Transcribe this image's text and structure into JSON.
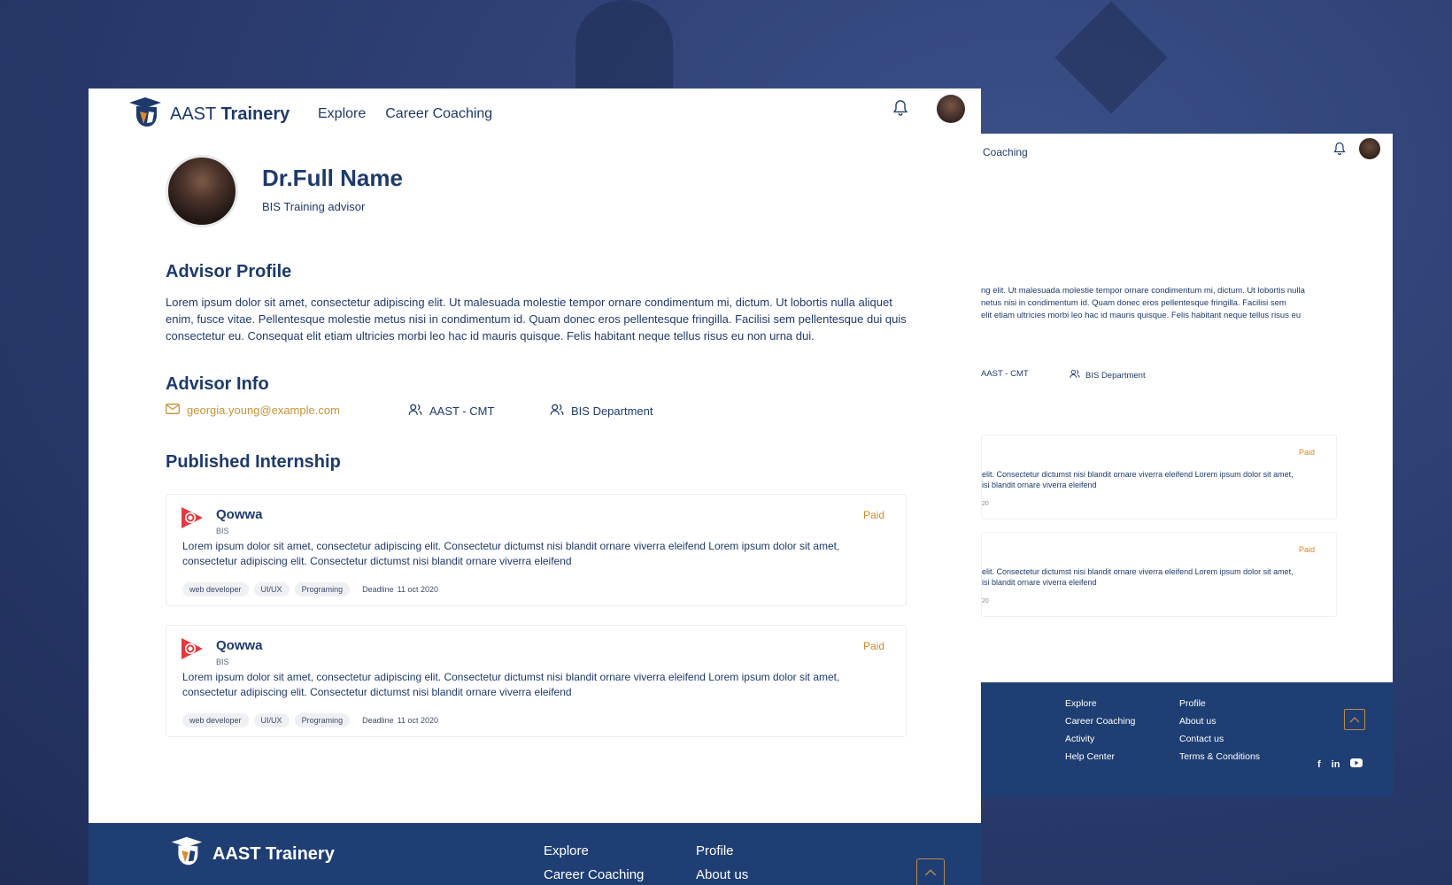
{
  "brand": {
    "name_light": "AAST",
    "name_bold": "Trainery",
    "footer_name": "AAST Trainery"
  },
  "nav": {
    "explore": "Explore",
    "career_coaching": "Career Coaching"
  },
  "profile": {
    "name": "Dr.Full Name",
    "role": "BIS Training advisor"
  },
  "advisor_profile": {
    "heading": "Advisor Profile",
    "text": "Lorem ipsum dolor sit amet, consectetur adipiscing elit. Ut malesuada molestie tempor ornare condimentum mi, dictum. Ut lobortis nulla aliquet enim, fusce vitae. Pellentesque molestie metus nisi in condimentum id. Quam donec eros pellentesque fringilla. Facilisi sem pellentesque dui quis consectetur eu. Consequat elit etiam ultricies morbi leo hac id mauris quisque. Felis habitant neque tellus risus eu non urna dui."
  },
  "advisor_info": {
    "heading": "Advisor Info",
    "email": "georgia.young@example.com",
    "institution": "AAST - CMT",
    "department": "BIS Department"
  },
  "internships": {
    "heading": "Published Internship",
    "items": [
      {
        "company": "Qowwa",
        "dept": "BIS",
        "status": "Paid",
        "desc": "Lorem ipsum dolor sit amet, consectetur adipiscing elit. Consectetur dictumst nisi blandit ornare viverra eleifend Lorem ipsum dolor sit amet, consectetur adipiscing elit. Consectetur dictumst nisi blandit ornare viverra eleifend",
        "tags": [
          "web developer",
          "UI/UX",
          "Programing"
        ],
        "deadline_label": "Deadline",
        "deadline_date": "11 oct 2020"
      },
      {
        "company": "Qowwa",
        "dept": "BIS",
        "status": "Paid",
        "desc": "Lorem ipsum dolor sit amet, consectetur adipiscing elit. Consectetur dictumst nisi blandit ornare viverra eleifend Lorem ipsum dolor sit amet, consectetur adipiscing elit. Consectetur dictumst nisi blandit ornare viverra eleifend",
        "tags": [
          "web developer",
          "UI/UX",
          "Programing"
        ],
        "deadline_label": "Deadline",
        "deadline_date": "11 oct 2020"
      }
    ]
  },
  "footer": {
    "col1": [
      "Explore",
      "Career Coaching",
      "Activity",
      "Help Center"
    ],
    "col2": [
      "Profile",
      "About us",
      "Contact us",
      "Terms & Conditions"
    ]
  },
  "back_preview": {
    "top_link": "Coaching",
    "para_lines": [
      "ng elit. Ut malesuada molestie tempor ornare condimentum mi, dictum. Ut lobortis nulla",
      "netus nisi in condimentum id. Quam donec eros pellentesque fringilla. Facilisi sem",
      " elit etiam ultricies morbi leo hac id mauris quisque. Felis habitant neque tellus risus eu"
    ],
    "institution": "AAST - CMT",
    "department": "BIS Department",
    "card_status": "Paid",
    "card_line1": "elit. Consectetur dictumst nisi blandit ornare viverra eleifend Lorem ipsum dolor sit amet,",
    "card_line2": "isi blandit ornare viverra eleifend",
    "card_tiny": "20"
  },
  "colors": {
    "navy": "#1e3a6b",
    "footer": "#1f3f74",
    "accent": "#d08a2a",
    "email": "#c99338"
  }
}
